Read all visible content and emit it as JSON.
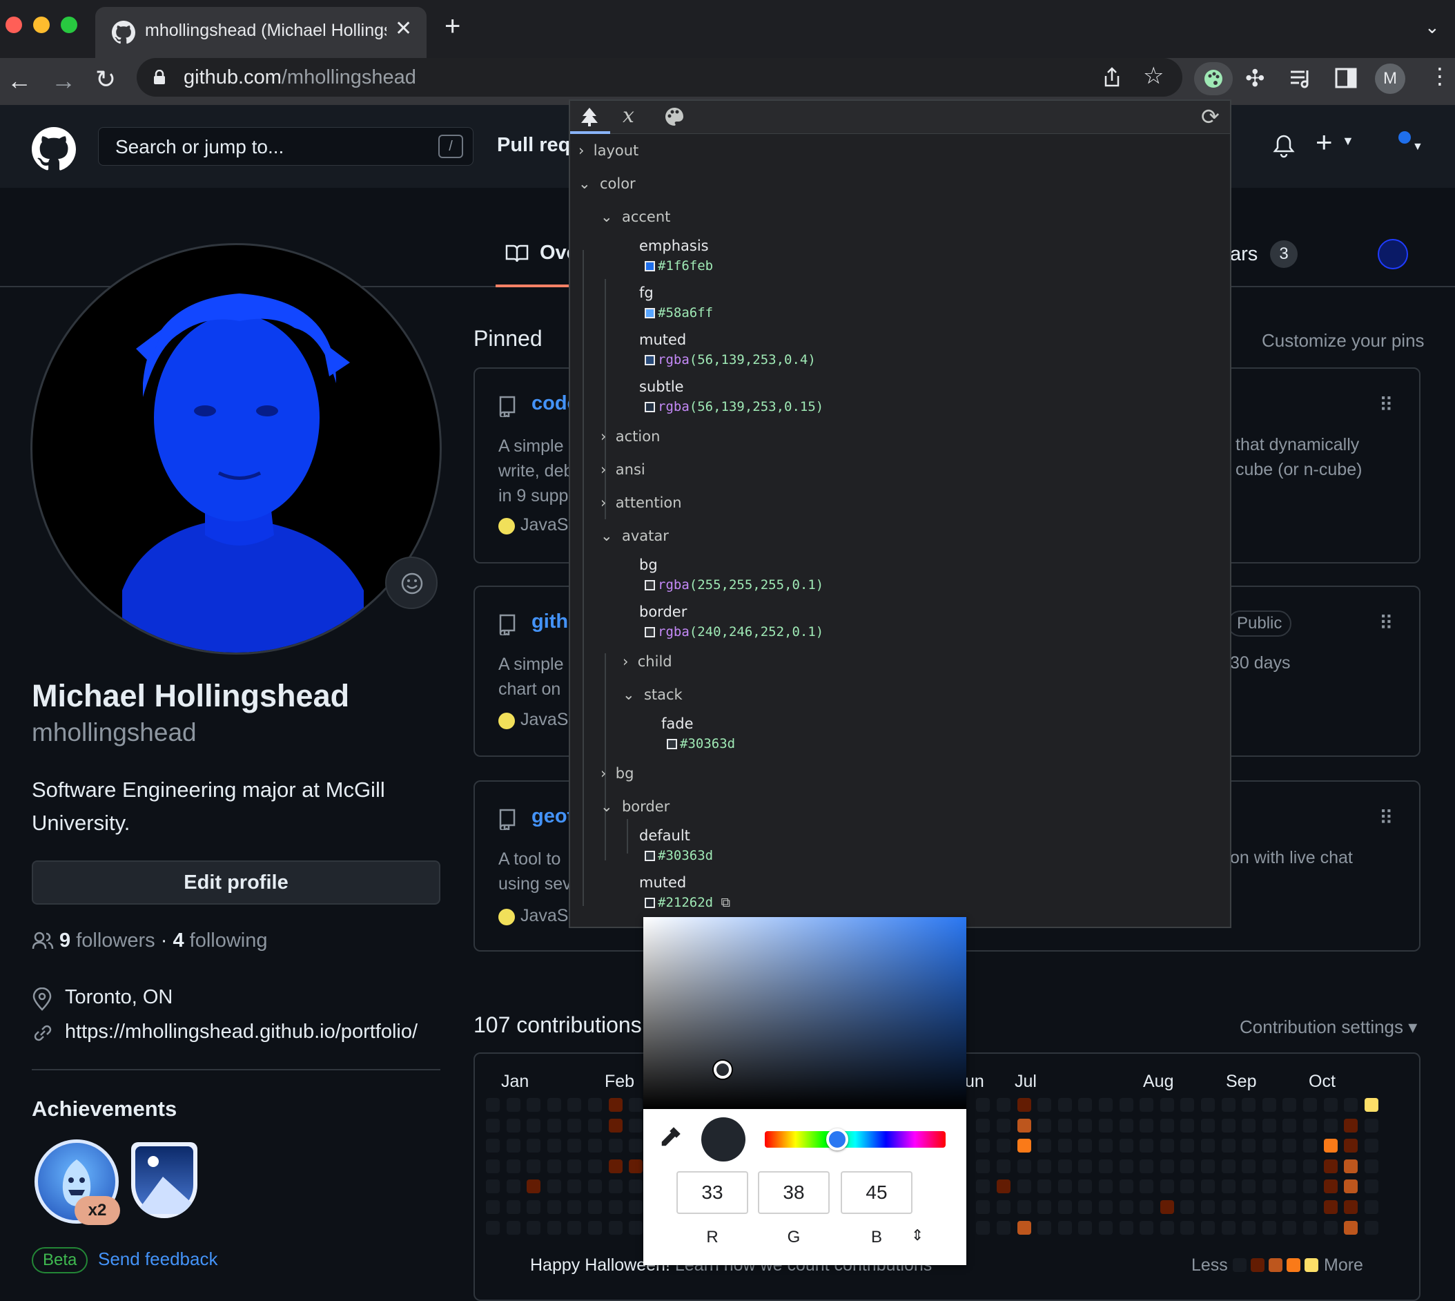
{
  "browser": {
    "tab_title": "mhollingshead (Michael Hollingshead)",
    "url_host": "github.com",
    "url_path": "/mhollingshead",
    "profile_initial": "M"
  },
  "github": {
    "search_placeholder": "Search or jump to...",
    "search_shortcut": "/",
    "nav_pull": "Pull requ",
    "tab_overview": "Ove",
    "tab_stars": "ars",
    "stars_count": "3"
  },
  "profile": {
    "name": "Michael Hollingshead",
    "username": "mhollingshead",
    "bio": "Software Engineering major at McGill University.",
    "edit_label": "Edit profile",
    "followers_count": "9",
    "followers_label": "followers",
    "separator": "·",
    "following_count": "4",
    "following_label": "following",
    "location": "Toronto, ON",
    "website": "https://mhollingshead.github.io/portfolio/",
    "achievements_title": "Achievements",
    "achievement_multiplier": "x2",
    "beta_label": "Beta",
    "feedback_label": "Send feedback"
  },
  "pinned": {
    "title": "Pinned",
    "customize": "Customize your pins",
    "cards": [
      {
        "name": "code",
        "desc1": "A simple",
        "desc2": "write, deb",
        "desc3": "in 9 supp",
        "lang": "JavaSc",
        "right1": "that dynamically",
        "right2": "cube (or n-cube)"
      },
      {
        "name": "githu",
        "desc1": "A simple",
        "desc2": "chart on",
        "lang": "JavaSc",
        "badge": "Public",
        "right1": "30 days"
      },
      {
        "name": "geot",
        "desc1": "A tool to",
        "desc2": "using sev",
        "lang": "JavaSc",
        "right1": "on with live chat"
      }
    ]
  },
  "contributions": {
    "title": "107 contributions",
    "settings": "Contribution settings",
    "months": [
      "Jan",
      "Feb",
      "un",
      "Jul",
      "Aug",
      "Sep",
      "Oct"
    ],
    "footer": "Happy Halloween!",
    "footer_link": "Learn how we count contributions",
    "less": "Less",
    "more": "More",
    "colors": {
      "empty": "#161b22",
      "l1": "#631c03",
      "l2": "#bd561d",
      "l3": "#fa7a18",
      "l4": "#fddf68"
    }
  },
  "devtools": {
    "tree": {
      "layout": "layout",
      "color": "color",
      "accent": "accent",
      "emphasis": {
        "key": "emphasis",
        "value": "#1f6feb",
        "color": "#1f6feb"
      },
      "fg": {
        "key": "fg",
        "value": "#58a6ff",
        "color": "#58a6ff"
      },
      "muted": {
        "key": "muted",
        "fn": "rgba",
        "args": "(56,139,253,0.4)"
      },
      "subtle": {
        "key": "subtle",
        "fn": "rgba",
        "args": "(56,139,253,0.15)"
      },
      "action": "action",
      "ansi": "ansi",
      "attention": "attention",
      "avatar": "avatar",
      "avatar_bg": {
        "key": "bg",
        "fn": "rgba",
        "args": "(255,255,255,0.1)"
      },
      "avatar_border": {
        "key": "border",
        "fn": "rgba",
        "args": "(240,246,252,0.1)"
      },
      "child": "child",
      "stack": "stack",
      "fade": {
        "key": "fade",
        "value": "#30363d",
        "color": "#30363d"
      },
      "bg": "bg",
      "border": "border",
      "border_default": {
        "key": "default",
        "value": "#30363d",
        "color": "#30363d"
      },
      "border_muted": {
        "key": "muted",
        "value": "#21262d",
        "color": "#21262d"
      }
    }
  },
  "color_picker": {
    "r": "33",
    "g": "38",
    "b": "45",
    "label_r": "R",
    "label_g": "G",
    "label_b": "B",
    "current_color": "#21262d",
    "hue_position": 0.4
  }
}
